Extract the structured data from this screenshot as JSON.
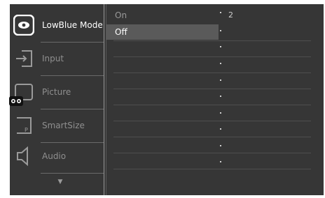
{
  "sidebar": {
    "items": [
      {
        "label": "LowBlue Mode",
        "icon": "eye-icon",
        "active": true
      },
      {
        "label": "Input",
        "icon": "input-icon",
        "active": false
      },
      {
        "label": "Picture",
        "icon": "picture-icon",
        "active": false
      },
      {
        "label": "SmartSize",
        "icon": "smartsize-icon",
        "active": false
      },
      {
        "label": "Audio",
        "icon": "speaker-icon",
        "active": false
      }
    ],
    "scroll_icon": "chevron-down-icon"
  },
  "submenu": {
    "items": [
      {
        "label": "On",
        "selected": false
      },
      {
        "label": "Off",
        "selected": true
      }
    ]
  },
  "value_column": {
    "values": [
      "2"
    ]
  },
  "colors": {
    "panel": "#363636",
    "selected_row": "#5a5a5a",
    "active_text": "#ffffff",
    "inactive_text": "#8f8f8f"
  }
}
